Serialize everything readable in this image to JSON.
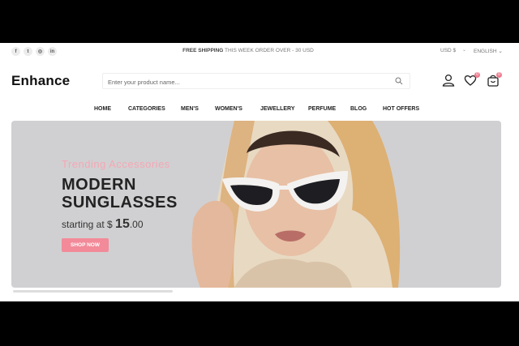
{
  "topbar": {
    "socials": [
      {
        "icon": "facebook-icon",
        "glyph": "f"
      },
      {
        "icon": "twitter-icon",
        "glyph": "t"
      },
      {
        "icon": "instagram-icon",
        "glyph": "◎"
      },
      {
        "icon": "linkedin-icon",
        "glyph": "in"
      }
    ],
    "shipping_bold": "FREE SHIPPING",
    "shipping_rest": " THIS WEEK ORDER OVER - 30 USD",
    "currency": "USD $",
    "language": "ENGLISH"
  },
  "header": {
    "logo": "Enhance",
    "search_placeholder": "Enter your product name...",
    "wishlist_count": "0",
    "cart_count": "0"
  },
  "nav": {
    "items": [
      "HOME",
      "CATEGORIES",
      "MEN'S",
      "WOMEN'S",
      "JEWELLERY",
      "PERFUME",
      "BLOG",
      "HOT OFFERS"
    ]
  },
  "hero": {
    "subtitle": "Trending Accessories",
    "title_line1": "MODERN",
    "title_line2": "SUNGLASSES",
    "price_prefix": "starting at $ ",
    "price_whole": "15",
    "price_cents": ".00",
    "button": "SHOP NOW"
  },
  "colors": {
    "accent": "#f28a99",
    "hero_bg": "#d0d0d2"
  }
}
